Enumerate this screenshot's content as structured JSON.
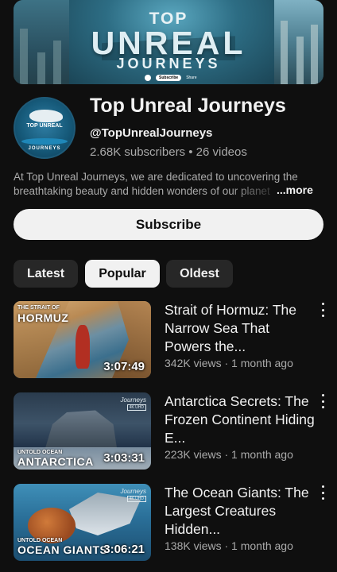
{
  "banner": {
    "title_line1": "TOP",
    "title_line2": "UNREAL",
    "title_line3": "JOURNEYS",
    "mini_subscribe": "Subscribe",
    "mini_share": "Share"
  },
  "channel": {
    "avatar_line1": "TOP UNREAL",
    "avatar_line2": "JOURNEYS",
    "name": "Top Unreal Journeys",
    "handle": "@TopUnrealJourneys",
    "subscribers": "2.68K subscribers",
    "separator": " • ",
    "videos": "26 videos",
    "description_line1": "At Top Unreal Journeys, we are dedicated to uncovering the",
    "description_line2": "breathtaking beauty and hidden wonders of our planet",
    "more": "...more"
  },
  "subscribe_label": "Subscribe",
  "filters": [
    {
      "label": "Latest",
      "selected": false
    },
    {
      "label": "Popular",
      "selected": true
    },
    {
      "label": "Oldest",
      "selected": false
    }
  ],
  "videos": [
    {
      "title": "Strait of Hormuz: The Narrow Sea That Powers the...",
      "meta": "342K views · 1 month ago",
      "duration": "3:07:49",
      "thumb_tag1": "THE STRAIT OF",
      "thumb_tag2": "HORMUZ"
    },
    {
      "title": "Antarctica Secrets: The Frozen Continent Hiding E...",
      "meta": "223K views · 1 month ago",
      "duration": "3:03:31",
      "thumb_tag1": "UNTOLD OCEAN",
      "thumb_tag2": "ANTARCTICA",
      "thumb_brand": "Journeys",
      "thumb_hd": "4K UHD"
    },
    {
      "title": "The Ocean Giants: The Largest Creatures Hidden...",
      "meta": "138K views · 1 month ago",
      "duration": "3:06:21",
      "thumb_tag1": "UNTOLD OCEAN",
      "thumb_tag2": "OCEAN GIANTS",
      "thumb_brand": "Journeys",
      "thumb_hd": "4K UHD"
    }
  ]
}
